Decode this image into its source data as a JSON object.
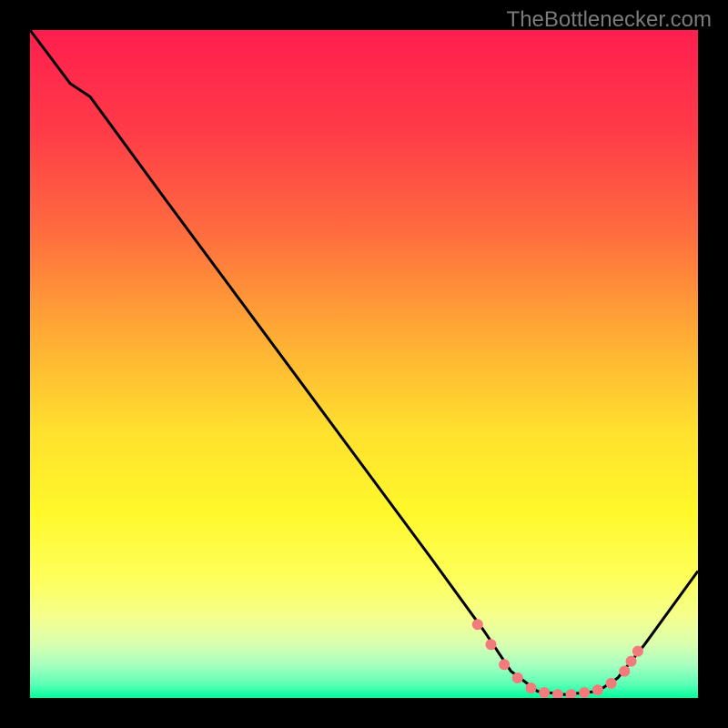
{
  "watermark": "TheBottlenecker.com",
  "chart_data": {
    "type": "line",
    "title": "",
    "xlabel": "",
    "ylabel": "",
    "xlim": [
      0,
      100
    ],
    "ylim": [
      0,
      100
    ],
    "curve_points": [
      {
        "x": 0,
        "y": 100
      },
      {
        "x": 6,
        "y": 92
      },
      {
        "x": 9,
        "y": 90
      },
      {
        "x": 20,
        "y": 75
      },
      {
        "x": 40,
        "y": 48
      },
      {
        "x": 60,
        "y": 21
      },
      {
        "x": 68,
        "y": 10
      },
      {
        "x": 72,
        "y": 4
      },
      {
        "x": 76,
        "y": 1
      },
      {
        "x": 80,
        "y": 0.5
      },
      {
        "x": 85,
        "y": 1
      },
      {
        "x": 88,
        "y": 3
      },
      {
        "x": 92,
        "y": 8
      },
      {
        "x": 100,
        "y": 19
      }
    ],
    "highlight_points": [
      {
        "x": 67,
        "y": 11
      },
      {
        "x": 69,
        "y": 8
      },
      {
        "x": 71,
        "y": 5
      },
      {
        "x": 73,
        "y": 3
      },
      {
        "x": 75,
        "y": 1.5
      },
      {
        "x": 77,
        "y": 0.8
      },
      {
        "x": 79,
        "y": 0.5
      },
      {
        "x": 81,
        "y": 0.5
      },
      {
        "x": 83,
        "y": 0.8
      },
      {
        "x": 85,
        "y": 1.2
      },
      {
        "x": 87,
        "y": 2.2
      },
      {
        "x": 89,
        "y": 4
      },
      {
        "x": 90,
        "y": 5.5
      },
      {
        "x": 91,
        "y": 7
      }
    ],
    "gradient_stops": [
      {
        "offset": 0,
        "color": "#ff1e4e"
      },
      {
        "offset": 15,
        "color": "#ff3b48"
      },
      {
        "offset": 30,
        "color": "#ff6b3f"
      },
      {
        "offset": 45,
        "color": "#ffa935"
      },
      {
        "offset": 60,
        "color": "#ffe02e"
      },
      {
        "offset": 72,
        "color": "#fff82b"
      },
      {
        "offset": 82,
        "color": "#feff5a"
      },
      {
        "offset": 88,
        "color": "#f4ff8e"
      },
      {
        "offset": 92,
        "color": "#d8ffb0"
      },
      {
        "offset": 95,
        "color": "#a8ffc0"
      },
      {
        "offset": 98,
        "color": "#5affb5"
      },
      {
        "offset": 100,
        "color": "#00ff9a"
      }
    ]
  }
}
